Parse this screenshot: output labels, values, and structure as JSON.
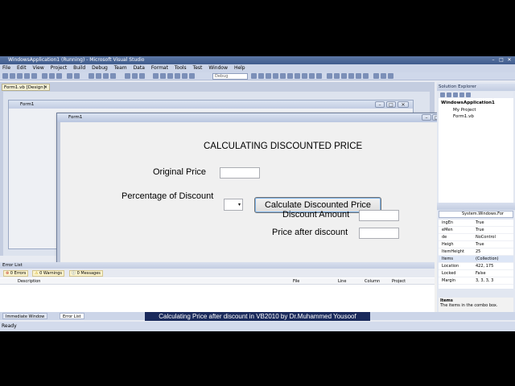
{
  "vs": {
    "title": "WindowsApplication1 (Running) - Microsoft Visual Studio",
    "menu": [
      "File",
      "Edit",
      "View",
      "Project",
      "Build",
      "Debug",
      "Team",
      "Data",
      "Format",
      "Tools",
      "Test",
      "Window",
      "Help"
    ],
    "config": "Debug",
    "status": "Ready"
  },
  "designer": {
    "tab": "Form1.vb [Design]",
    "form_title": "Form1"
  },
  "app": {
    "form_title": "Form1",
    "heading": "CALCULATING DISCOUNTED PRICE",
    "original_price_label": "Original Price",
    "percentage_label": "Percentage of Discount",
    "calc_button": "Calculate Discounted Price",
    "discount_amount_label": "Discount Amount",
    "price_after_label": "Price after discount",
    "original_price_value": "",
    "discount_amount_value": "",
    "price_after_value": ""
  },
  "solution_explorer": {
    "title": "Solution Explorer",
    "items": [
      "WindowsApplication1",
      "My Project",
      "Form1.vb"
    ]
  },
  "properties": {
    "object": "System.Windows.For",
    "rows": [
      [
        "ingEn",
        "True"
      ],
      [
        "eMen",
        "True"
      ],
      [
        "de",
        "NoControl"
      ],
      [
        "Heigh",
        "True"
      ],
      [
        "ItemHeight",
        "25"
      ],
      [
        "Items",
        "(Collection)"
      ],
      [
        "Location",
        "422, 175"
      ],
      [
        "Locked",
        "False"
      ],
      [
        "Margin",
        "3, 3, 3, 3"
      ]
    ],
    "help_title": "Items",
    "help_text": "The items in the combo box."
  },
  "error_list": {
    "title": "Error List",
    "errors": "0 Errors",
    "warnings": "0 Warnings",
    "messages": "0 Messages",
    "columns": [
      "Description",
      "File",
      "Line",
      "Column",
      "Project"
    ]
  },
  "bottom_tabs": [
    "Immediate Window",
    "Error List"
  ],
  "video_caption": "Calculating Price after discount  in VB2010  by  Dr.Muhammed Yousoof"
}
